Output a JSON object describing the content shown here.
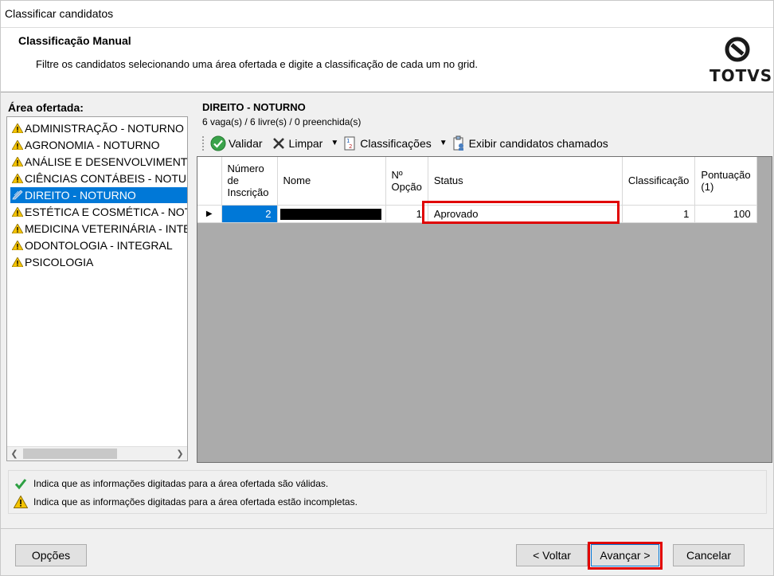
{
  "window": {
    "title": "Classificar candidatos"
  },
  "header": {
    "title": "Classificação Manual",
    "description": "Filtre os candidatos selecionando uma área ofertada e digite a classificação de cada um no grid.",
    "logo_text": "TOTVS"
  },
  "areas": {
    "label": "Área ofertada:",
    "items": [
      {
        "label": "ADMINISTRAÇÃO - NOTURNO",
        "status_icon": "warning-icon"
      },
      {
        "label": "AGRONOMIA - NOTURNO",
        "status_icon": "warning-icon"
      },
      {
        "label": "ANÁLISE E DESENVOLVIMENTO",
        "status_icon": "warning-icon"
      },
      {
        "label": "CIÊNCIAS CONTÁBEIS - NOTURNO",
        "status_icon": "warning-icon"
      },
      {
        "label": "DIREITO - NOTURNO",
        "status_icon": "edit-icon",
        "selected": true
      },
      {
        "label": "ESTÉTICA E COSMÉTICA - NOTURNO",
        "status_icon": "warning-icon"
      },
      {
        "label": "MEDICINA VETERINÁRIA - INTEGRAL",
        "status_icon": "warning-icon"
      },
      {
        "label": "ODONTOLOGIA - INTEGRAL",
        "status_icon": "warning-icon"
      },
      {
        "label": "PSICOLOGIA",
        "status_icon": "warning-icon"
      }
    ]
  },
  "course": {
    "title": "DIREITO - NOTURNO",
    "summary": "6 vaga(s) / 6 livre(s) / 0 preenchida(s)"
  },
  "toolbar": {
    "validar": "Validar",
    "limpar": "Limpar",
    "classificacoes": "Classificações",
    "exibir": "Exibir candidatos chamados"
  },
  "grid": {
    "columns": {
      "numero": "Número de Inscrição",
      "nome": "Nome",
      "opcao": "Nº Opção",
      "status": "Status",
      "classificacao": "Classificação",
      "pontuacao": "Pontuação (1)"
    },
    "rows": [
      {
        "numero": "2",
        "nome": "",
        "opcao": "1",
        "status": "Aprovado",
        "classificacao": "1",
        "pontuacao": "100"
      }
    ]
  },
  "legend": {
    "valid": "Indica que as informações digitadas para a área ofertada são válidas.",
    "incomplete": "Indica que as informações digitadas para a área ofertada estão incompletas."
  },
  "buttons": {
    "opcoes": "Opções",
    "voltar": "< Voltar",
    "avancar": "Avançar >",
    "cancelar": "Cancelar"
  },
  "colors": {
    "selection": "#0078d7",
    "highlight": "#e00000",
    "warning": "#f5c400",
    "valid": "#2ea043"
  }
}
